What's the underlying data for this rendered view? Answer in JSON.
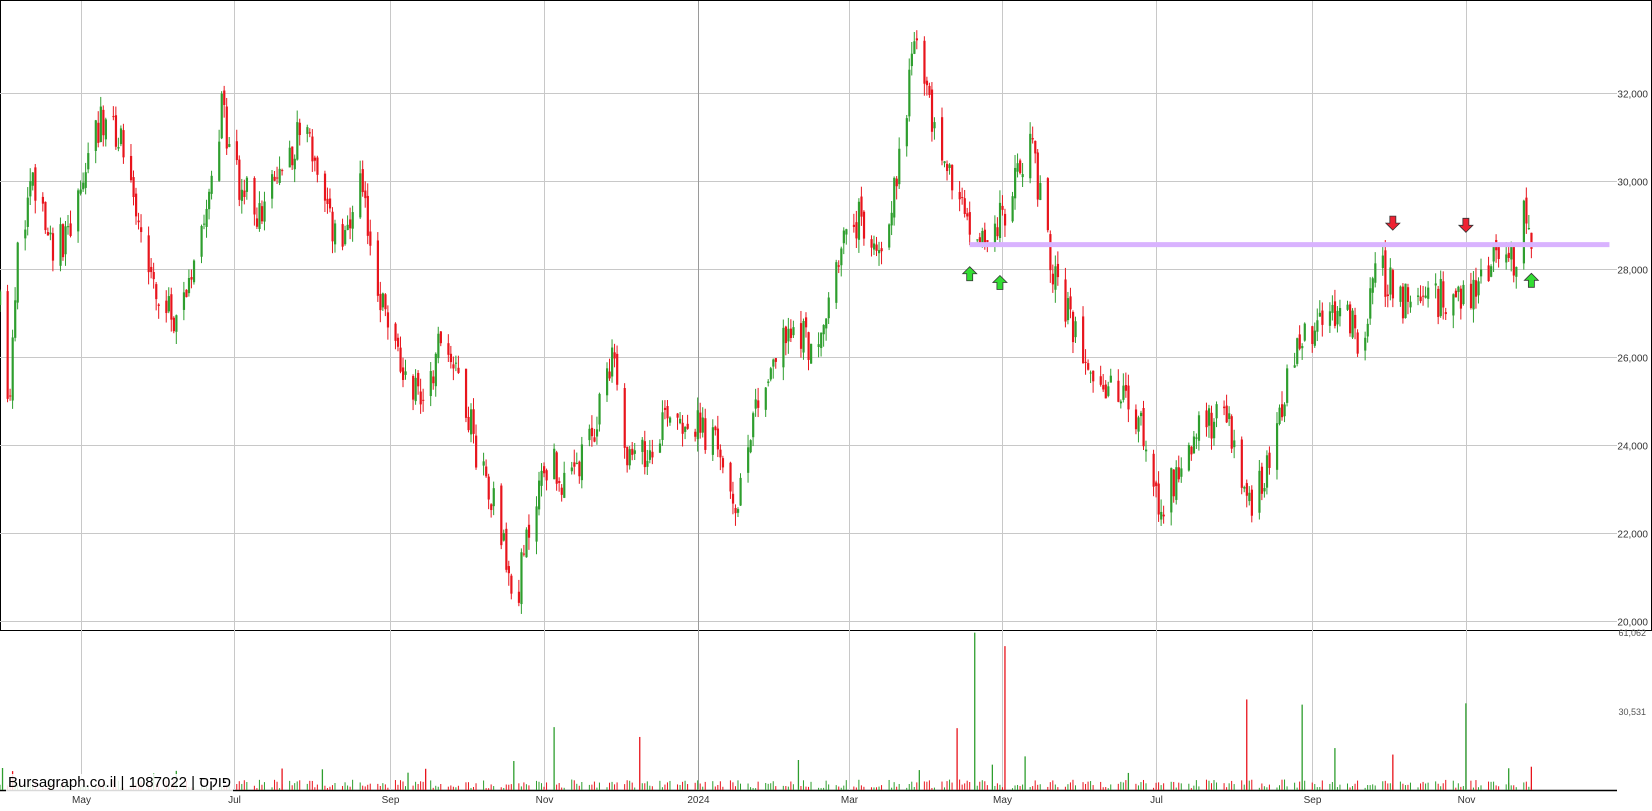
{
  "watermark": "Bursagraph.co.il | 1087022 | פוקס",
  "colors": {
    "up": "#2e9e2e",
    "down": "#e8141c",
    "grid": "#c8c8c8",
    "major_grid": "#9a9a9a",
    "resistance": "#d9b3ff",
    "buy_arrow": "#33dd33",
    "sell_arrow": "#ee2233"
  },
  "chart_data": [
    {
      "type": "candlestick",
      "title": "",
      "xlabel": "",
      "ylabel": "",
      "x_ticks": [
        {
          "label": "May",
          "date": "2023-05-01"
        },
        {
          "label": "Jul",
          "date": "2023-07-01"
        },
        {
          "label": "Sep",
          "date": "2023-09-01"
        },
        {
          "label": "Nov",
          "date": "2023-11-01"
        },
        {
          "label": "2024",
          "date": "2024-01-01",
          "major": true
        },
        {
          "label": "Mar",
          "date": "2024-03-01"
        },
        {
          "label": "May",
          "date": "2024-05-01"
        },
        {
          "label": "Jul",
          "date": "2024-07-01"
        },
        {
          "label": "Sep",
          "date": "2024-09-01"
        },
        {
          "label": "Nov",
          "date": "2024-11-01"
        }
      ],
      "xlim": [
        "2023-03-30",
        "2024-12-31"
      ],
      "y_ticks": [
        20000,
        22000,
        24000,
        26000,
        28000,
        30000,
        32000
      ],
      "y_tick_labels": [
        "20,000",
        "22,000",
        "24,000",
        "26,000",
        "28,000",
        "30,000",
        "32,000"
      ],
      "ylim": [
        19800,
        34100
      ],
      "grid": true,
      "price_path": [
        [
          "2023-03-30",
          27200
        ],
        [
          "2023-04-03",
          24900
        ],
        [
          "2023-04-06",
          28500
        ],
        [
          "2023-04-12",
          29800
        ],
        [
          "2023-04-20",
          28400
        ],
        [
          "2023-04-28",
          29000
        ],
        [
          "2023-05-05",
          30800
        ],
        [
          "2023-05-12",
          31600
        ],
        [
          "2023-05-20",
          30500
        ],
        [
          "2023-05-26",
          28600
        ],
        [
          "2023-06-03",
          26900
        ],
        [
          "2023-06-10",
          27100
        ],
        [
          "2023-06-20",
          29700
        ],
        [
          "2023-06-26",
          31600
        ],
        [
          "2023-07-03",
          29900
        ],
        [
          "2023-07-12",
          29200
        ],
        [
          "2023-07-21",
          30500
        ],
        [
          "2023-07-30",
          31400
        ],
        [
          "2023-08-05",
          29300
        ],
        [
          "2023-08-14",
          28500
        ],
        [
          "2023-08-20",
          29800
        ],
        [
          "2023-08-28",
          27400
        ],
        [
          "2023-09-05",
          25800
        ],
        [
          "2023-09-14",
          25100
        ],
        [
          "2023-09-22",
          26600
        ],
        [
          "2023-09-30",
          25300
        ],
        [
          "2023-10-05",
          23900
        ],
        [
          "2023-10-14",
          22500
        ],
        [
          "2023-10-20",
          20200
        ],
        [
          "2023-10-28",
          22700
        ],
        [
          "2023-11-03",
          23800
        ],
        [
          "2023-11-10",
          22900
        ],
        [
          "2023-11-20",
          24100
        ],
        [
          "2023-11-28",
          26200
        ],
        [
          "2023-12-05",
          23600
        ],
        [
          "2023-12-12",
          23800
        ],
        [
          "2023-12-20",
          24900
        ],
        [
          "2024-01-01",
          24400
        ],
        [
          "2024-01-10",
          23900
        ],
        [
          "2024-01-15",
          22300
        ],
        [
          "2024-01-23",
          24800
        ],
        [
          "2024-02-02",
          26200
        ],
        [
          "2024-02-10",
          26700
        ],
        [
          "2024-02-18",
          26000
        ],
        [
          "2024-02-26",
          28400
        ],
        [
          "2024-03-05",
          29100
        ],
        [
          "2024-03-12",
          28300
        ],
        [
          "2024-03-20",
          30000
        ],
        [
          "2024-03-27",
          33300
        ],
        [
          "2024-04-03",
          31400
        ],
        [
          "2024-04-10",
          30100
        ],
        [
          "2024-04-18",
          28900
        ],
        [
          "2024-04-26",
          28700
        ],
        [
          "2024-05-04",
          29500
        ],
        [
          "2024-05-12",
          31200
        ],
        [
          "2024-05-18",
          28800
        ],
        [
          "2024-05-25",
          27100
        ],
        [
          "2024-06-02",
          26300
        ],
        [
          "2024-06-10",
          25300
        ],
        [
          "2024-06-20",
          25000
        ],
        [
          "2024-06-28",
          23900
        ],
        [
          "2024-07-03",
          22600
        ],
        [
          "2024-07-12",
          23800
        ],
        [
          "2024-07-22",
          24600
        ],
        [
          "2024-07-30",
          24500
        ],
        [
          "2024-08-06",
          22500
        ],
        [
          "2024-08-14",
          23600
        ],
        [
          "2024-08-22",
          25400
        ],
        [
          "2024-08-28",
          26400
        ],
        [
          "2024-09-05",
          26800
        ],
        [
          "2024-09-14",
          27100
        ],
        [
          "2024-09-20",
          26300
        ],
        [
          "2024-09-27",
          28100
        ],
        [
          "2024-10-02",
          27600
        ],
        [
          "2024-10-10",
          27100
        ],
        [
          "2024-10-18",
          27200
        ],
        [
          "2024-10-26",
          27500
        ],
        [
          "2024-11-01",
          27300
        ],
        [
          "2024-11-08",
          27900
        ],
        [
          "2024-11-14",
          28500
        ],
        [
          "2024-11-20",
          28100
        ],
        [
          "2024-11-24",
          29600
        ],
        [
          "2024-11-27",
          28200
        ]
      ],
      "resistance_line": {
        "from": "2024-04-18",
        "to": "2024-12-28",
        "value": 28560
      },
      "markers": [
        {
          "type": "buy",
          "date": "2024-04-18",
          "value": 27900
        },
        {
          "type": "buy",
          "date": "2024-04-30",
          "value": 27700
        },
        {
          "type": "sell",
          "date": "2024-10-03",
          "value": 29050
        },
        {
          "type": "sell",
          "date": "2024-11-01",
          "value": 29000
        },
        {
          "type": "buy",
          "date": "2024-11-27",
          "value": 27750
        }
      ]
    },
    {
      "type": "bar",
      "title": "",
      "ylabel": "",
      "y_ticks": [
        30531,
        61062
      ],
      "y_tick_labels": [
        "30,531",
        "61,062"
      ],
      "ylim": [
        0,
        61062
      ],
      "typical_volume": 2800,
      "spikes": [
        {
          "date": "2023-03-31",
          "value": 8500
        },
        {
          "date": "2023-04-04",
          "value": 7300
        },
        {
          "date": "2023-05-30",
          "value": 6400
        },
        {
          "date": "2023-06-08",
          "value": 7400
        },
        {
          "date": "2023-07-20",
          "value": 8300
        },
        {
          "date": "2023-08-05",
          "value": 8000
        },
        {
          "date": "2023-09-08",
          "value": 6700
        },
        {
          "date": "2023-09-15",
          "value": 8200
        },
        {
          "date": "2023-10-20",
          "value": 11200
        },
        {
          "date": "2023-11-05",
          "value": 24300
        },
        {
          "date": "2023-12-09",
          "value": 20500
        },
        {
          "date": "2024-02-10",
          "value": 11600
        },
        {
          "date": "2024-03-29",
          "value": 7700
        },
        {
          "date": "2024-04-13",
          "value": 23900
        },
        {
          "date": "2024-04-20",
          "value": 60800
        },
        {
          "date": "2024-04-27",
          "value": 9800
        },
        {
          "date": "2024-05-02",
          "value": 55600
        },
        {
          "date": "2024-05-10",
          "value": 13000
        },
        {
          "date": "2024-06-20",
          "value": 6600
        },
        {
          "date": "2024-08-06",
          "value": 35000
        },
        {
          "date": "2024-08-28",
          "value": 33000
        },
        {
          "date": "2024-09-10",
          "value": 16200
        },
        {
          "date": "2024-10-03",
          "value": 13700
        },
        {
          "date": "2024-11-01",
          "value": 33500
        },
        {
          "date": "2024-11-18",
          "value": 8400
        },
        {
          "date": "2024-11-27",
          "value": 9000
        }
      ]
    }
  ]
}
